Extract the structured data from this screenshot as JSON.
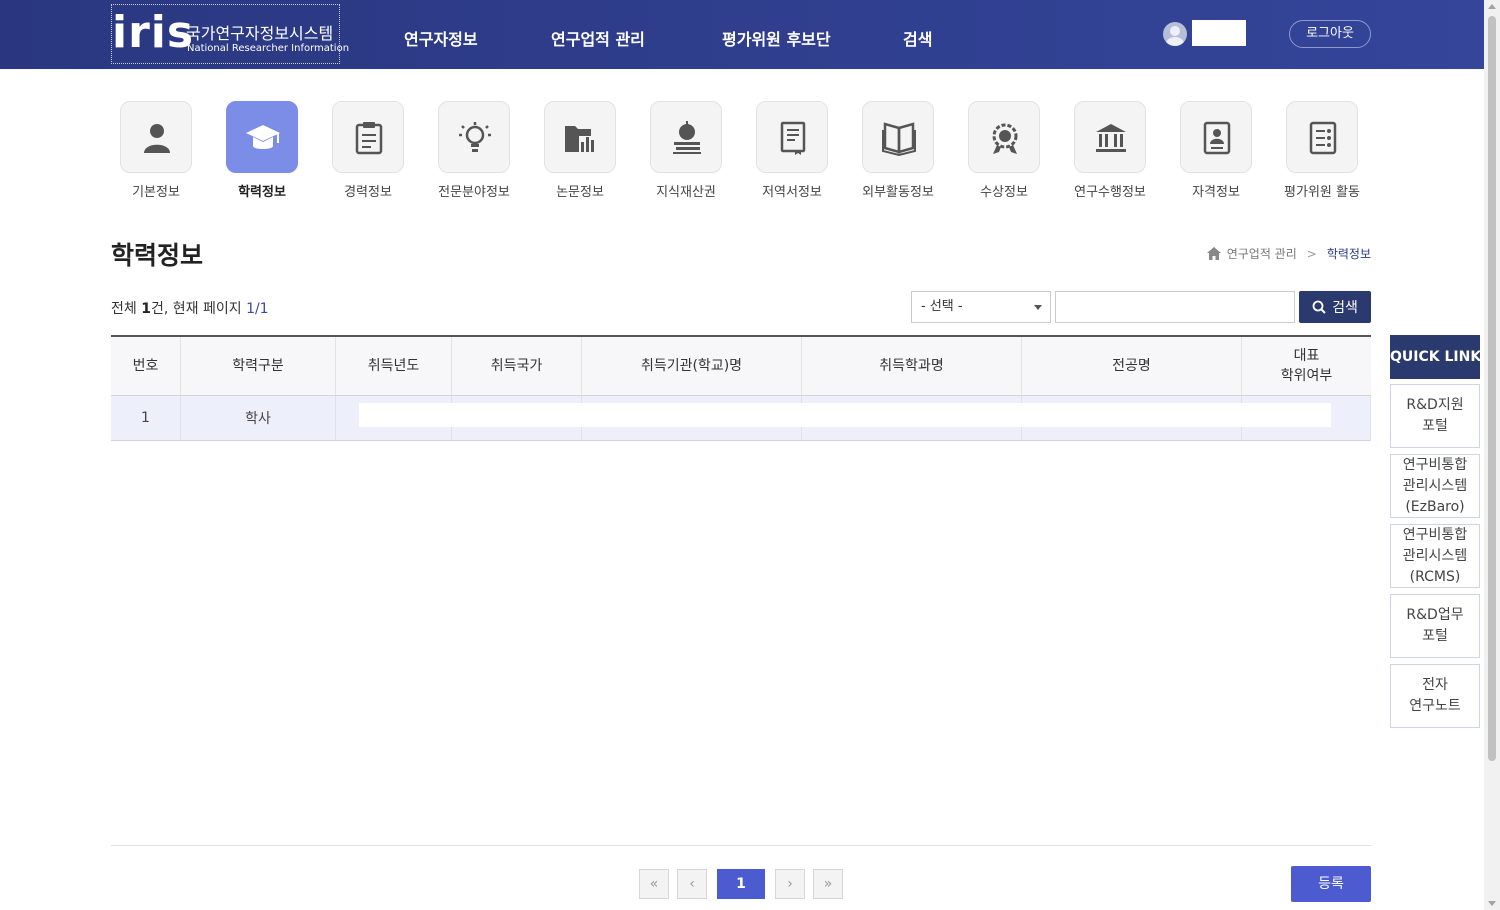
{
  "header": {
    "logo_text": "iris",
    "system_name_kr": "국가연구자정보시스템",
    "system_name_en": "National Researcher Information",
    "nav": [
      "연구자정보",
      "연구업적 관리",
      "평가위원 후보단",
      "검색"
    ],
    "logout_label": "로그아웃"
  },
  "categories": [
    {
      "label": "기본정보",
      "icon": "person-icon",
      "active": false
    },
    {
      "label": "학력정보",
      "icon": "graduation-cap-icon",
      "active": true
    },
    {
      "label": "경력정보",
      "icon": "clipboard-icon",
      "active": false
    },
    {
      "label": "전문분야정보",
      "icon": "lightbulb-icon",
      "active": false
    },
    {
      "label": "논문정보",
      "icon": "folder-chart-icon",
      "active": false
    },
    {
      "label": "지식재산권",
      "icon": "apple-books-icon",
      "active": false
    },
    {
      "label": "저역서정보",
      "icon": "book-icon",
      "active": false
    },
    {
      "label": "외부활동정보",
      "icon": "open-book-icon",
      "active": false
    },
    {
      "label": "수상정보",
      "icon": "award-icon",
      "active": false
    },
    {
      "label": "연구수행정보",
      "icon": "institution-icon",
      "active": false
    },
    {
      "label": "자격정보",
      "icon": "id-card-icon",
      "active": false
    },
    {
      "label": "평가위원 활동",
      "icon": "checklist-icon",
      "active": false
    }
  ],
  "page": {
    "title": "학력정보",
    "breadcrumb": [
      "연구업적 관리",
      "학력정보"
    ]
  },
  "list": {
    "count_prefix": "전체 ",
    "count": "1",
    "count_suffix": "건, 현재 페이지 ",
    "page_info": "1/1"
  },
  "search": {
    "select_value": "- 선택 -",
    "input_value": "",
    "button_label": "검색"
  },
  "table": {
    "headers": [
      "번호",
      "학력구분",
      "취득년도",
      "취득국가",
      "취득기관(학교)명",
      "취득학과명",
      "전공명",
      "대표\n학위여부"
    ],
    "rows": [
      [
        "1",
        "학사",
        "",
        "",
        "",
        "",
        "",
        ""
      ]
    ]
  },
  "pagination": {
    "first": "«",
    "prev": "‹",
    "current": "1",
    "next": "›",
    "last": "»"
  },
  "register_label": "등록",
  "quick_links": {
    "title": "QUICK LINK",
    "items": [
      "R&D지원\n포털",
      "연구비통합\n관리시스템\n(EzBaro)",
      "연구비통합\n관리시스템\n(RCMS)",
      "R&D업무\n포털",
      "전자\n연구노트"
    ]
  },
  "colors": {
    "header_bg": "#2b3a87",
    "accent": "#4d5bd1",
    "active_category": "#7b8de6",
    "dark_button": "#2b3a6e"
  }
}
